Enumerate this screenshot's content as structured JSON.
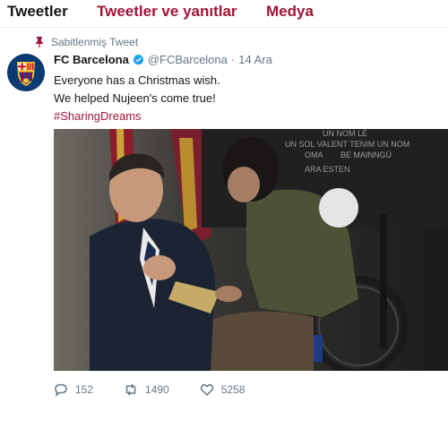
{
  "tabs": {
    "tweets": "Tweetler",
    "replies": "Tweetler ve yanıtlar",
    "media": "Medya"
  },
  "tweet": {
    "pinned_label": "Sabitlenmiş Tweet",
    "display_name": "FC Barcelona",
    "handle": "@FCBarcelona",
    "separator": "·",
    "date": "14 Ara",
    "line1": "Everyone has a Christmas wish.",
    "line2": "We helped Nujeen's come true!",
    "hashtag": "#SharingDreams",
    "counts": {
      "replies": "152",
      "retweets": "1490",
      "likes": "5258"
    }
  },
  "colors": {
    "accent": "#a11536",
    "muted": "#657786",
    "verified": "#1da1f2"
  },
  "icons": {
    "pin": "pin-icon",
    "verified": "verified-badge-icon",
    "reply": "reply-icon",
    "retweet": "retweet-icon",
    "like": "heart-icon"
  }
}
